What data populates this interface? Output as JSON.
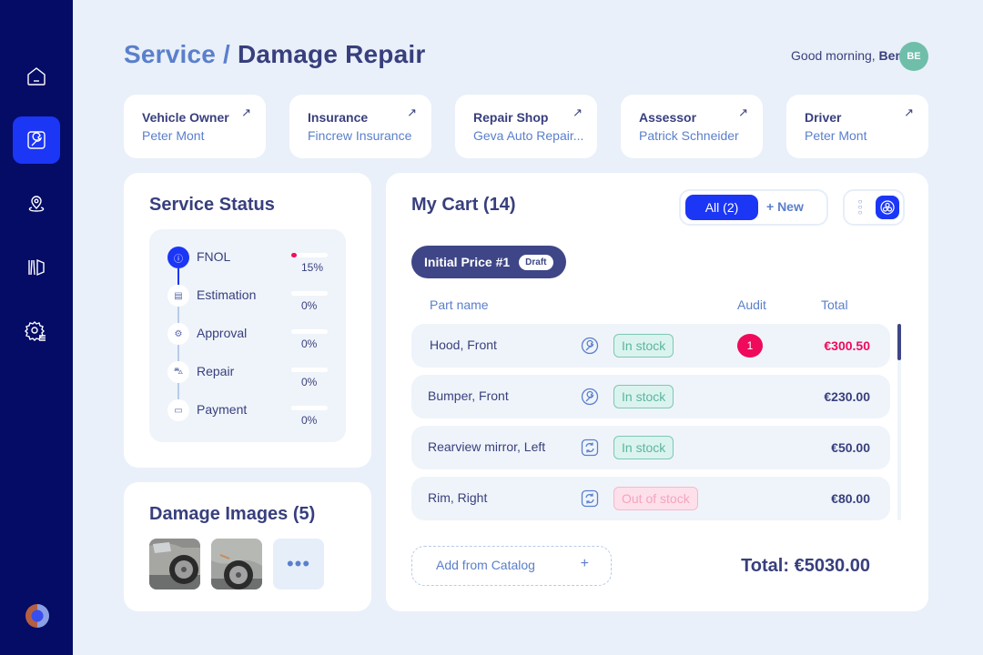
{
  "sidebar": {
    "items": [
      {
        "icon": "home-icon",
        "active": false
      },
      {
        "icon": "wrench-icon",
        "active": true
      },
      {
        "icon": "location-icon",
        "active": false
      },
      {
        "icon": "road-map-icon",
        "active": false
      },
      {
        "icon": "settings-icon",
        "active": false
      }
    ],
    "logo": "globe-logo"
  },
  "header": {
    "breadcrumb_parent": "Service",
    "separator": "/",
    "title": "Damage Repair",
    "greeting": "Good morning,",
    "user_name": "Ben",
    "avatar_initials": "BE"
  },
  "contacts": [
    {
      "role": "Vehicle Owner",
      "name": "Peter Mont"
    },
    {
      "role": "Insurance",
      "name": "Fincrew Insurance"
    },
    {
      "role": "Repair Shop",
      "name": "Geva Auto Repair..."
    },
    {
      "role": "Assessor",
      "name": "Patrick Schneider"
    },
    {
      "role": "Driver",
      "name": "Peter Mont"
    }
  ],
  "service_status": {
    "title": "Service Status",
    "steps": [
      {
        "label": "FNOL",
        "progress": 15,
        "progress_text": "15%",
        "active": true
      },
      {
        "label": "Estimation",
        "progress": 0,
        "progress_text": "0%",
        "active": false
      },
      {
        "label": "Approval",
        "progress": 0,
        "progress_text": "0%",
        "active": false
      },
      {
        "label": "Repair",
        "progress": 0,
        "progress_text": "0%",
        "active": false
      },
      {
        "label": "Payment",
        "progress": 0,
        "progress_text": "0%",
        "active": false
      }
    ]
  },
  "damage_images": {
    "title": "Damage Images (5)",
    "more_label": "•••"
  },
  "cart": {
    "title": "My Cart (14)",
    "filter_all": "All (2)",
    "new_label": "+ New",
    "price_label": "Initial Price #1",
    "draft_label": "Draft",
    "columns": {
      "part": "Part name",
      "audit": "Audit",
      "total": "Total"
    },
    "rows": [
      {
        "part": "Hood, Front",
        "icon": "wrench-icon",
        "stock": "In stock",
        "in_stock": true,
        "audit": "1",
        "total": "€300.50",
        "highlight": true
      },
      {
        "part": "Bumper, Front",
        "icon": "wrench-icon",
        "stock": "In stock",
        "in_stock": true,
        "audit": "",
        "total": "€230.00",
        "highlight": false
      },
      {
        "part": "Rearview mirror, Left",
        "icon": "replace-icon",
        "stock": "In stock",
        "in_stock": true,
        "audit": "",
        "total": "€50.00",
        "highlight": false
      },
      {
        "part": "Rim, Right",
        "icon": "replace-icon",
        "stock": "Out of stock",
        "in_stock": false,
        "audit": "",
        "total": "€80.00",
        "highlight": false
      }
    ],
    "add_label": "Add from Catalog",
    "add_plus": "+",
    "grand_total": "Total: €5030.00"
  },
  "colors": {
    "accent": "#1c36f6",
    "sidebar": "#040c66",
    "alert": "#ef0a5b",
    "success": "#5bb59f"
  }
}
